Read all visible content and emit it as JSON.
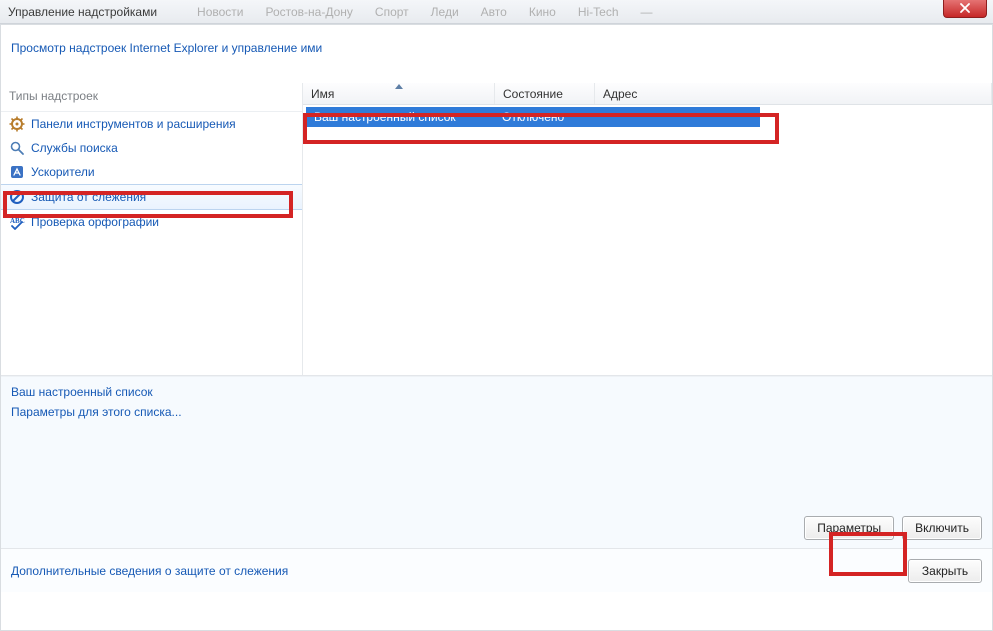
{
  "window": {
    "title": "Управление надстройками",
    "ghost_tabs": [
      "Новости",
      "Ростов-на-Дону",
      "Спорт",
      "Леди",
      "Авто",
      "Кино",
      "Hi-Tech",
      "—"
    ]
  },
  "header_link": "Просмотр надстроек Internet Explorer и управление ими",
  "sidebar": {
    "title": "Типы надстроек",
    "items": [
      {
        "icon": "gear",
        "label": "Панели инструментов и расширения"
      },
      {
        "icon": "search",
        "label": "Службы поиска"
      },
      {
        "icon": "accel",
        "label": "Ускорители"
      },
      {
        "icon": "shield",
        "label": "Защита от слежения",
        "selected": true
      },
      {
        "icon": "spell",
        "label": "Проверка орфографии"
      }
    ]
  },
  "list": {
    "columns": {
      "name": "Имя",
      "status": "Состояние",
      "address": "Адрес"
    },
    "row": {
      "name": "Ваш настроенный список",
      "status": "Отключено"
    }
  },
  "detail": {
    "title": "Ваш настроенный список",
    "settings_link": "Параметры для этого списка...",
    "buttons": {
      "params": "Параметры",
      "enable": "Включить"
    }
  },
  "footer": {
    "more_info": "Дополнительные сведения о защите от слежения",
    "close": "Закрыть"
  }
}
